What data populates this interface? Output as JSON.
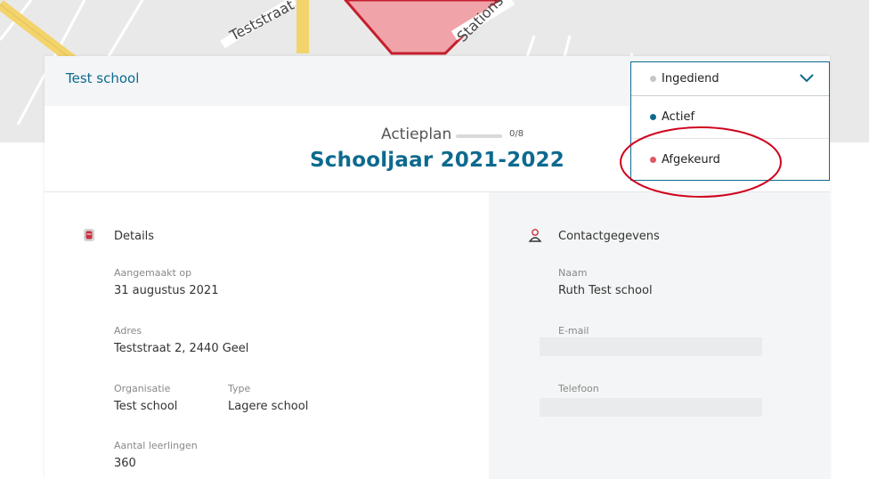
{
  "header": {
    "title": "Test school"
  },
  "status": {
    "selected": {
      "label": "Ingediend",
      "color": "#c4c7ca"
    },
    "options": [
      {
        "label": "Actief",
        "color": "#0e6a8e"
      },
      {
        "label": "Afgekeurd",
        "color": "#e0576a"
      }
    ]
  },
  "plan": {
    "label": "Actieplan",
    "count": "0/8",
    "progress": 0,
    "year": "Schooljaar 2021-2022"
  },
  "details": {
    "title": "Details",
    "created_label": "Aangemaakt op",
    "created_value": "31 augustus 2021",
    "address_label": "Adres",
    "address_value": "Teststraat 2, 2440 Geel",
    "org_label": "Organisatie",
    "org_value": "Test school",
    "type_label": "Type",
    "type_value": "Lagere school",
    "students_label": "Aantal leerlingen",
    "students_value": "360"
  },
  "contact": {
    "title": "Contactgegevens",
    "name_label": "Naam",
    "name_value": "Ruth Test school",
    "email_label": "E-mail",
    "email_value": "",
    "phone_label": "Telefoon",
    "phone_value": ""
  },
  "map": {
    "street_1": "Teststraat",
    "street_2": "Stationstraat"
  },
  "colors": {
    "accent": "#0e6a8e",
    "annotation": "#d0021b"
  },
  "icons": {
    "details": "bookmark-icon",
    "contact": "person-icon",
    "dropdown": "chevron-down-icon"
  }
}
